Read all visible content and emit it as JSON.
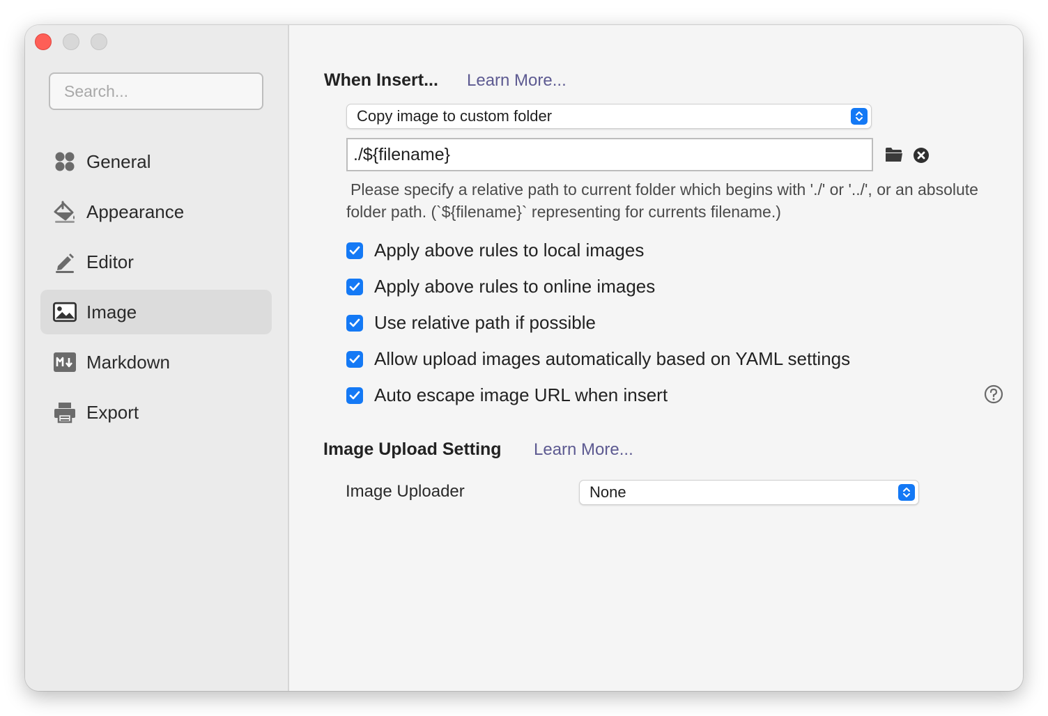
{
  "sidebar": {
    "search_placeholder": "Search...",
    "items": [
      {
        "label": "General",
        "icon": "grid-icon"
      },
      {
        "label": "Appearance",
        "icon": "paint-bucket-icon"
      },
      {
        "label": "Editor",
        "icon": "pencil-icon"
      },
      {
        "label": "Image",
        "icon": "image-icon",
        "active": true
      },
      {
        "label": "Markdown",
        "icon": "markdown-icon"
      },
      {
        "label": "Export",
        "icon": "printer-icon"
      }
    ]
  },
  "insert": {
    "title": "When Insert...",
    "learn_more": "Learn More...",
    "action_selected": "Copy image to custom folder",
    "path_value": "./${filename}",
    "hint": "Please specify a relative path to current folder which begins with './' or '../', or an absolute folder path. (`${filename}` representing for currents filename.)",
    "options": [
      {
        "label": "Apply above rules to local images",
        "checked": true
      },
      {
        "label": "Apply above rules to online images",
        "checked": true
      },
      {
        "label": "Use relative path if possible",
        "checked": true
      },
      {
        "label": "Allow upload images automatically based on YAML settings",
        "checked": true
      },
      {
        "label": "Auto escape image URL when insert",
        "checked": true
      }
    ]
  },
  "upload": {
    "title": "Image Upload Setting",
    "learn_more": "Learn More...",
    "uploader_label": "Image Uploader",
    "uploader_selected": "None"
  },
  "colors": {
    "accent": "#1479f5",
    "link": "#5d5a91",
    "close_light": "#fe5f57"
  }
}
